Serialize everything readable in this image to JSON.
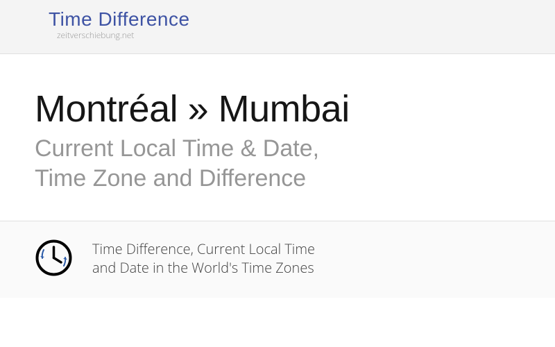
{
  "header": {
    "site_title": "Time Difference",
    "site_subtitle": "zeitverschiebung.net"
  },
  "main": {
    "heading": "Montréal » Mumbai",
    "subheading_line1": "Current Local Time & Date,",
    "subheading_line2": "Time Zone and Difference"
  },
  "footer": {
    "text_line1": "Time Difference, Current Local Time",
    "text_line2": "and Date in the World's Time Zones"
  }
}
